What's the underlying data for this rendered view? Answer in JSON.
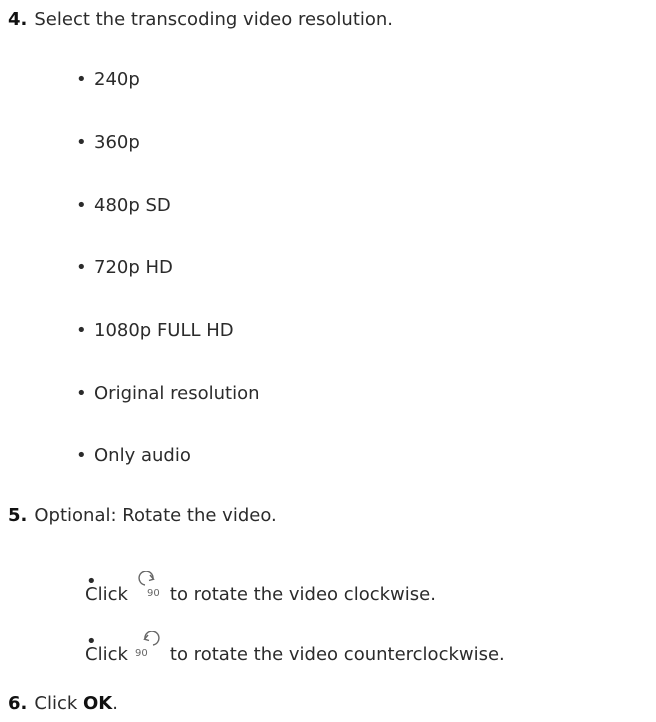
{
  "steps": [
    {
      "number": "4.",
      "text": "Select the transcoding video resolution."
    },
    {
      "number": "5.",
      "text": "Optional: Rotate the video."
    },
    {
      "number": "6.",
      "text_prefix": "Click ",
      "bold": "OK",
      "text_suffix": "."
    }
  ],
  "resolutions": [
    "240p",
    "360p",
    "480p SD",
    "720p HD",
    "1080p FULL HD",
    "Original resolution",
    "Only audio"
  ],
  "rotate_items": [
    {
      "prefix": "Click",
      "icon": "rotate-clockwise-90-icon",
      "icon_text": "90",
      "suffix": "to rotate the video clockwise."
    },
    {
      "prefix": "Click",
      "icon": "rotate-counterclockwise-90-icon",
      "icon_text": "90",
      "suffix": "to rotate the video counterclockwise."
    }
  ]
}
